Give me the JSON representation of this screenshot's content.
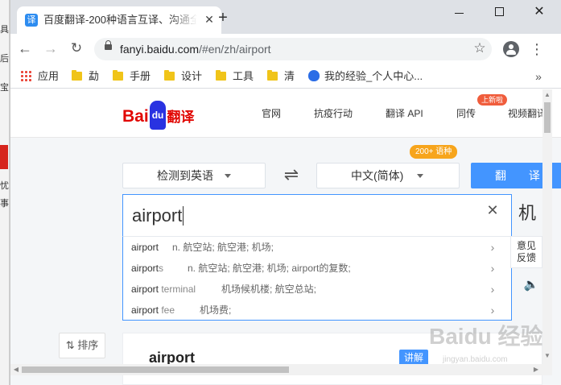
{
  "background": {
    "fragments": [
      "具",
      "后",
      "宝",
      "忧",
      "事"
    ]
  },
  "tab": {
    "favicon": "译",
    "title": "百度翻译-200种语言互译、沟通全",
    "close": "✕",
    "new_tab": "+"
  },
  "window_controls": {
    "close": "✕"
  },
  "toolbar": {
    "back": "←",
    "forward": "→",
    "reload": "↻",
    "url_host": "fanyi.baidu.com",
    "url_path": "/#en/zh/airport",
    "star": "☆",
    "menu": "⋮"
  },
  "bookmarks": {
    "items": [
      "应用",
      "勐",
      "手册",
      "设计",
      "工具",
      "清",
      "我的经验_个人中心..."
    ],
    "more": "»"
  },
  "site": {
    "logo_bai": "Bai",
    "logo_du": "du",
    "logo_fanyi": "翻译",
    "nav": [
      "官网",
      "抗疫行动",
      "翻译 API",
      "同传",
      "视频翻译"
    ],
    "nav_badge": "上新啦"
  },
  "translator": {
    "source_lang": "检测到英语",
    "swap": "⇌",
    "target_lang": "中文(简体)",
    "target_badge": "200+ 语种",
    "translate_button": "翻 译",
    "input_value": "airport",
    "clear": "✕",
    "result_peek": "机",
    "feedback": [
      "意见",
      "反馈"
    ],
    "speaker": "🔈"
  },
  "suggestions": [
    {
      "base": "airport",
      "rest": "",
      "def": "n. 航空站; 航空港; 机场;"
    },
    {
      "base": "airport",
      "rest": "s",
      "def": "n. 航空站; 航空港; 机场; airport的复数;"
    },
    {
      "base": "airport",
      "rest": " terminal",
      "def": "机场候机楼; 航空总站;"
    },
    {
      "base": "airport",
      "rest": " fee",
      "def": "机场费;"
    }
  ],
  "suggestion_arrow": "›",
  "sort": {
    "label": "⇅ 排序"
  },
  "dict": {
    "word": "airport",
    "tag": "讲解"
  },
  "watermark": {
    "main": "Baidu 经验",
    "sub": "jingyan.baidu.com"
  },
  "scroll": {
    "up": "▲",
    "down": "▼",
    "left": "◀",
    "right": "▶"
  }
}
